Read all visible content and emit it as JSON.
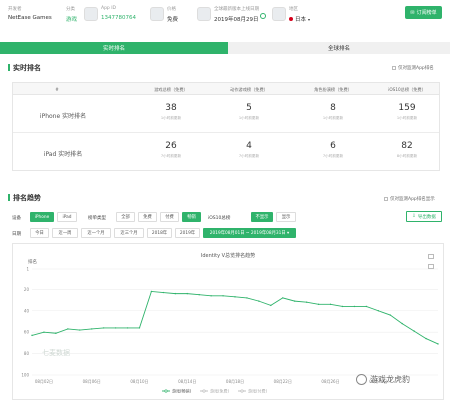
{
  "header": {
    "developer_label": "开发者",
    "developer": "NetEase Games",
    "category_label": "分类",
    "category": "游戏",
    "appid_label": "App ID",
    "appid": "1347780764",
    "price_label": "价格",
    "price": "免费",
    "update_label": "全球最新版本上线日期",
    "update": "2019年08月29日",
    "region_label": "地区",
    "region": "日本",
    "subscribe_label": "订阅榜单"
  },
  "tabs": {
    "realtime": "实时排名",
    "global": "全球排名"
  },
  "realtime": {
    "title": "实时排名",
    "checkbox_label": "仅对监测App排名",
    "columns": [
      "#",
      "游戏总榜（免费）",
      "动作游戏榜（免费）",
      "角色扮演榜（免费）",
      "iOS10总榜（免费）"
    ],
    "rows": [
      {
        "label": "iPhone 实时排名",
        "cells": [
          {
            "value": "38",
            "sub": "1小时前更新"
          },
          {
            "value": "5",
            "sub": "1小时前更新"
          },
          {
            "value": "8",
            "sub": "1小时前更新"
          },
          {
            "value": "159",
            "sub": "1小时前更新"
          }
        ]
      },
      {
        "label": "iPad 实时排名",
        "cells": [
          {
            "value": "26",
            "sub": "7小时前更新"
          },
          {
            "value": "4",
            "sub": "7小时前更新"
          },
          {
            "value": "6",
            "sub": "7小时前更新"
          },
          {
            "value": "82",
            "sub": "8小时前更新"
          }
        ]
      }
    ]
  },
  "trend": {
    "title": "排名趋势",
    "checkbox_label": "仅对监测App排名显示",
    "device_label": "设备",
    "devices": [
      "iPhone",
      "iPad"
    ],
    "type_label": "榜单类型",
    "types": [
      "全部",
      "免费",
      "付费",
      "畅销"
    ],
    "ios_label": "iOS10总榜",
    "ios_opts": [
      "不显示",
      "显示"
    ],
    "export_label": "导出数据",
    "date_label": "日期",
    "dates": [
      "今日",
      "近一周",
      "近一个月",
      "近三个月",
      "2018年",
      "2019年"
    ],
    "date_range": "2019年08月01日 ~ 2019年08月31日 ▾"
  },
  "chart_data": {
    "type": "line",
    "title": "Identity V总览排名趋势",
    "ylabel": "排名",
    "watermark": "七麦数据",
    "y_ticks": [
      "1",
      "20",
      "40",
      "60",
      "80",
      "100"
    ],
    "x_ticks": [
      "08月02日",
      "08月06日",
      "08月10日",
      "08月14日",
      "08月18日",
      "08月22日",
      "08月26日",
      "08月30日"
    ],
    "ylim": [
      1,
      100
    ],
    "series": [
      {
        "name": "游戏(畅销)",
        "color": "#2fb36b",
        "x_start_day": 1,
        "values": [
          63,
          60,
          61,
          57,
          58,
          57,
          56,
          56,
          56,
          56,
          22,
          23,
          24,
          24,
          25,
          26,
          26,
          27,
          28,
          31,
          35,
          28,
          31,
          32,
          34,
          34,
          36,
          36,
          36,
          40,
          44,
          52,
          59,
          66,
          71
        ]
      }
    ],
    "legend": [
      "游戏(畅销)",
      "游戏(免费)",
      "游戏(付费)"
    ]
  },
  "footer": {
    "logo_text": "游戏龙虎豹"
  }
}
